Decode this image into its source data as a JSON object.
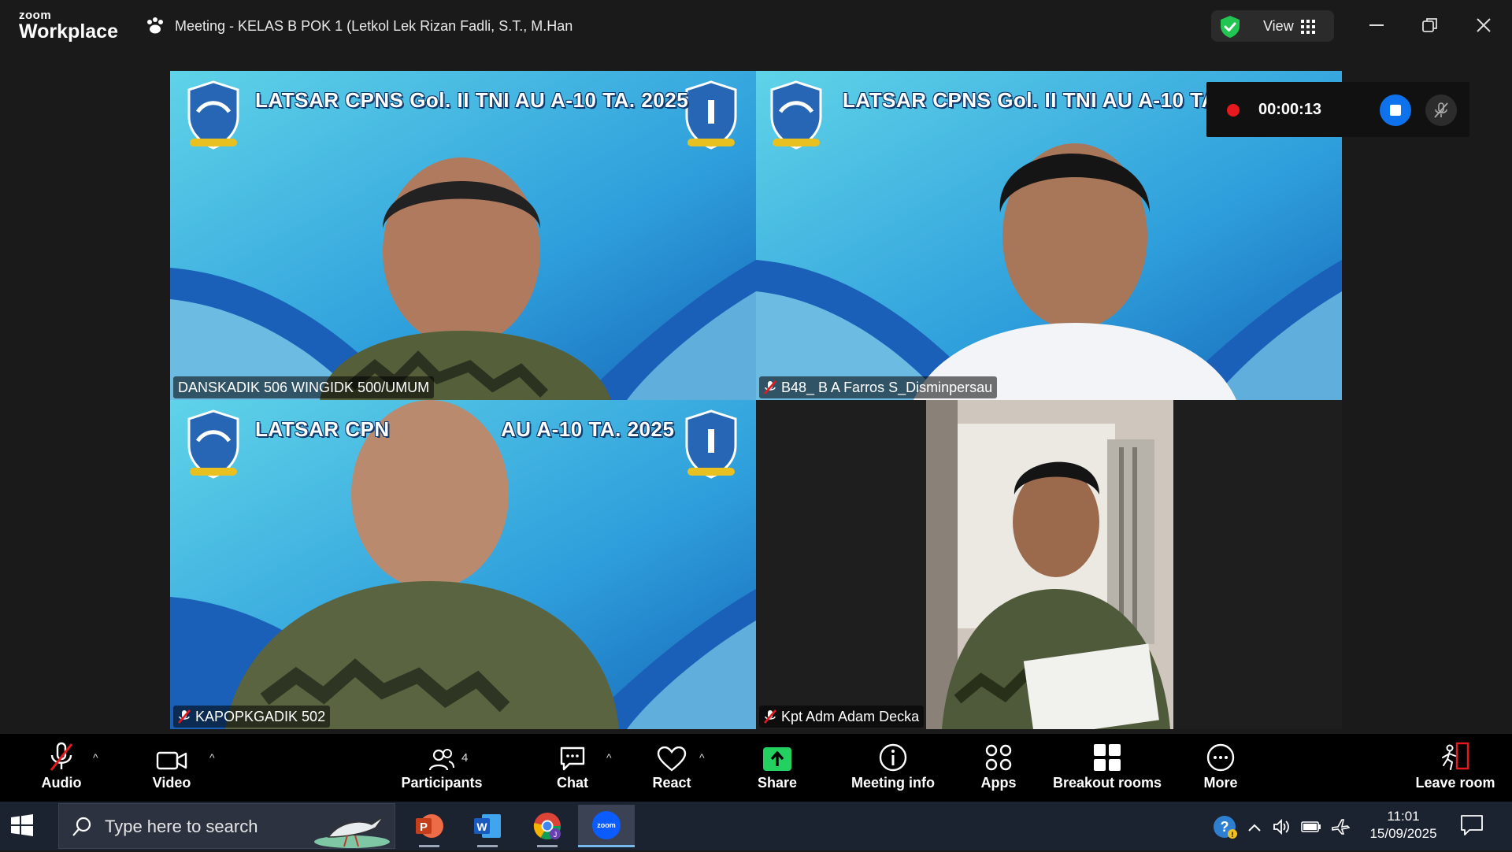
{
  "app": {
    "brand_top": "zoom",
    "brand_bottom": "Workplace",
    "meeting_title": "Meeting - KELAS B POK 1 (Letkol Lek Rizan Fadli, S.T., M.Han",
    "view_label": "View"
  },
  "recording": {
    "time": "00:00:13"
  },
  "participants": [
    {
      "name": "DANSKADIK 506 WINGIDK 500/UMUM",
      "banner": "LATSAR CPNS  Gol. II  TNI AU A-10 TA. 2025",
      "muted": false,
      "active_speaker": true
    },
    {
      "name": "B48_ B A Farros S_Disminpersau",
      "banner": "LATSAR CPNS  Gol. II  TNI AU A-10 TA. 2",
      "muted": true,
      "active_speaker": false
    },
    {
      "name": "KAPOPKGADIK 502",
      "banner_left": "LATSAR CPN",
      "banner_right": "AU A-10 TA. 2025",
      "muted": true,
      "active_speaker": false
    },
    {
      "name": "Kpt Adm Adam Decka",
      "muted": true,
      "active_speaker": false
    }
  ],
  "toolbar": {
    "audio": "Audio",
    "video": "Video",
    "participants": "Participants",
    "participants_count": "4",
    "chat": "Chat",
    "react": "React",
    "share": "Share",
    "meeting_info": "Meeting info",
    "apps": "Apps",
    "breakout_rooms": "Breakout rooms",
    "more": "More",
    "leave_room": "Leave room"
  },
  "taskbar": {
    "search_placeholder": "Type here to search",
    "time": "11:01",
    "date": "15/09/2025",
    "apps": [
      "powerpoint-icon",
      "word-icon",
      "chrome-icon",
      "zoom-icon"
    ]
  },
  "colors": {
    "active_border": "#2bd08a",
    "share_green": "#23d160",
    "record_red": "#e8191e",
    "stop_blue": "#0e72ed",
    "banner_bg": "#2e9ad6"
  }
}
